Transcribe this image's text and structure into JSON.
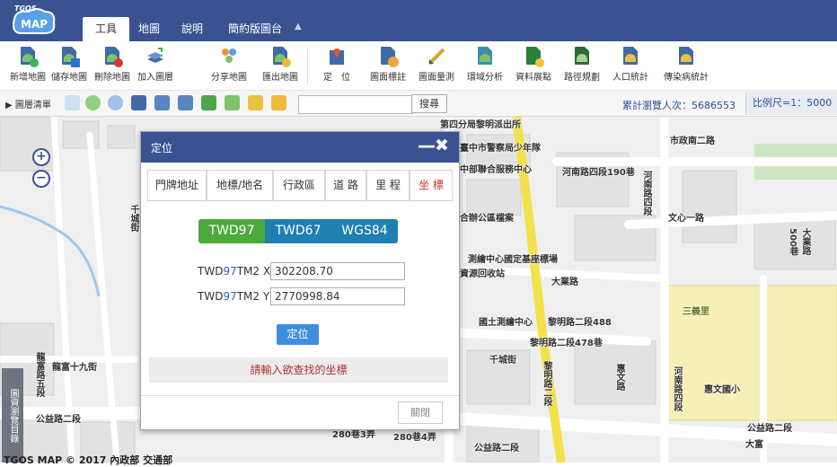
{
  "topbar": {
    "logo_top": "TGOS",
    "logo_text": "MAP",
    "tabs": [
      {
        "label": "工具",
        "active": true
      },
      {
        "label": "地圖",
        "active": false
      },
      {
        "label": "說明",
        "active": false
      },
      {
        "label": "簡約版圖台",
        "active": false
      }
    ],
    "collapse_icon": "triangle-up-icon",
    "bg_color": "#3a5390"
  },
  "toolbar": {
    "items": [
      {
        "label": "新增地圖",
        "icon": "new-map-icon"
      },
      {
        "label": "儲存地圖",
        "icon": "save-map-icon"
      },
      {
        "label": "刪除地圖",
        "icon": "delete-map-icon"
      },
      {
        "label": "加入圖層",
        "icon": "add-layer-icon"
      },
      {
        "label": "分享地圖",
        "icon": "share-map-icon"
      },
      {
        "label": "匯出地圖",
        "icon": "export-map-icon"
      },
      {
        "label": "定　位",
        "icon": "locate-icon"
      },
      {
        "label": "圖面標註",
        "icon": "annotate-icon"
      },
      {
        "label": "圖面量測",
        "icon": "measure-icon"
      },
      {
        "label": "環域分析",
        "icon": "buffer-analysis-icon"
      },
      {
        "label": "資料展點",
        "icon": "plot-points-icon"
      },
      {
        "label": "路徑規劃",
        "icon": "route-plan-icon"
      },
      {
        "label": "人口統計",
        "icon": "population-stats-icon"
      },
      {
        "label": "傳染病統計",
        "icon": "disease-stats-icon"
      }
    ]
  },
  "toolbar2": {
    "layer_list_label": "▶ 圖層清單",
    "search_value": "",
    "search_button": "搜尋",
    "visits": "累計瀏覽人次：5686553",
    "scale": "比例尺=1：5000"
  },
  "map": {
    "zoom_in": "+",
    "zoom_out": "−",
    "side_tab": "圖資瀏覽目錄",
    "copyright": "TGOS MAP © 2017 內政部 交通部",
    "labels": [
      {
        "text": "市政南二路"
      },
      {
        "text": "河南路四段190巷"
      },
      {
        "text": "文心一路"
      },
      {
        "text": "大業路"
      },
      {
        "text": "黎明路二段488"
      },
      {
        "text": "黎明路二段478巷"
      },
      {
        "text": "國土測繪中心"
      },
      {
        "text": "測繪中心國定基座標場"
      },
      {
        "text": "千城街"
      },
      {
        "text": "三義里"
      },
      {
        "text": "惠文國小"
      },
      {
        "text": "公益路二段"
      },
      {
        "text": "公益路二段"
      },
      {
        "text": "公益路二段"
      },
      {
        "text": "龍富十九街"
      },
      {
        "text": "280巷4弄"
      },
      {
        "text": "280巷3弄"
      },
      {
        "text": "黎明路二段"
      },
      {
        "text": "河南路四段"
      },
      {
        "text": "惠文路"
      },
      {
        "text": "大富"
      },
      {
        "text": "第四分局黎明派出所"
      },
      {
        "text": "臺中市警察局少年隊"
      },
      {
        "text": "中部聯合服務中心"
      },
      {
        "text": "合辦公區檔案"
      },
      {
        "text": "資源回收站"
      },
      {
        "text": "500巷"
      },
      {
        "text": "大業路"
      },
      {
        "text": "千城街"
      },
      {
        "text": "河南路四段"
      },
      {
        "text": "龍富路五段"
      }
    ]
  },
  "dialog": {
    "title": "定位",
    "minimize": "—",
    "close": "✖",
    "tabs": [
      {
        "label": "門牌地址",
        "active": false
      },
      {
        "label": "地標/地名",
        "active": false
      },
      {
        "label": "行政區",
        "active": false
      },
      {
        "label": "道 路",
        "active": false
      },
      {
        "label": "里 程",
        "active": false
      },
      {
        "label": "坐 標",
        "active": true
      }
    ],
    "coord_systems": [
      {
        "label": "TWD97",
        "color": "#4caa3c"
      },
      {
        "label": "TWD67",
        "color": "#1f7fb0"
      },
      {
        "label": "WGS84",
        "color": "#1f7fb0"
      }
    ],
    "x_label": {
      "pre": "TWD",
      "hl": "97",
      "post": "TM2 X"
    },
    "x_value": "302208.70",
    "y_label": {
      "pre": "TWD",
      "hl": "97",
      "post": "TM2 Y"
    },
    "y_value": "2770998.84",
    "locate_button": "定位",
    "message": "請輸入欲查找的坐標",
    "close_button": "關閉"
  }
}
